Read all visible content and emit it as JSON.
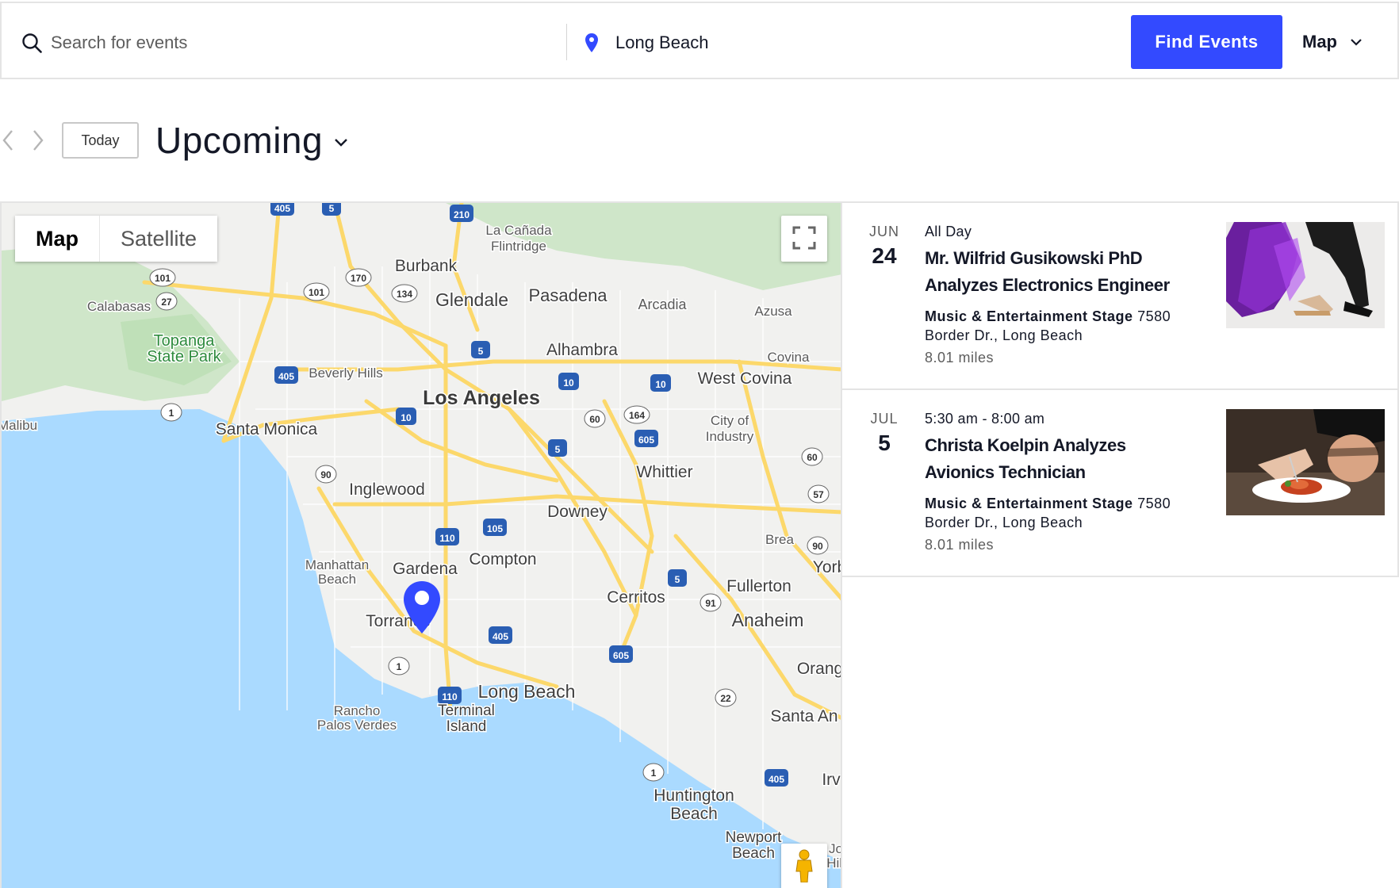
{
  "search": {
    "placeholder": "Search for events",
    "location_value": "Long Beach",
    "find_label": "Find Events",
    "view_label": "Map"
  },
  "datebar": {
    "today_label": "Today",
    "range_label": "Upcoming"
  },
  "map": {
    "type_map": "Map",
    "type_satellite": "Satellite",
    "labels": [
      "La Cañada",
      "Flintridge",
      "Burbank",
      "Glendale",
      "Pasadena",
      "Arcadia",
      "Azusa",
      "Calabasas",
      "Topanga",
      "State Park",
      "Alhambra",
      "Covina",
      "Beverly Hills",
      "Los Angeles",
      "West Covina",
      "Malibu",
      "Santa Monica",
      "City of",
      "Industry",
      "Whittier",
      "Inglewood",
      "Downey",
      "Brea",
      "Manhattan",
      "Beach",
      "Gardena",
      "Compton",
      "Yorb",
      "Fullerton",
      "Cerritos",
      "Anaheim",
      "Torrance",
      "Orang",
      "Long Beach",
      "Rancho",
      "Palos Verdes",
      "Terminal",
      "Island",
      "Santa An",
      "Irv",
      "Huntington",
      "Beach",
      "Newport",
      "Beach",
      "Jo",
      "Hill"
    ],
    "shields": [
      "405",
      "5",
      "210",
      "170",
      "101",
      "134",
      "101",
      "27",
      "5",
      "405",
      "10",
      "10",
      "1",
      "10",
      "60",
      "164",
      "605",
      "5",
      "60",
      "90",
      "57",
      "110",
      "105",
      "90",
      "5",
      "91",
      "405",
      "605",
      "1",
      "110",
      "22",
      "1",
      "405"
    ]
  },
  "events": [
    {
      "month": "JUN",
      "day": "24",
      "time": "All Day",
      "title": "Mr. Wilfrid Gusikowski PhD Analyzes Electronics Engineer",
      "venue": "Music & Entertainment Stage",
      "address": "7580 Border Dr., Long Beach",
      "distance": "8.01 miles"
    },
    {
      "month": "JUL",
      "day": "5",
      "time": "5:30 am - 8:00 am",
      "title": "Christa Koelpin Analyzes Avionics Technician",
      "venue": "Music & Entertainment Stage",
      "address": "7580 Border Dr., Long Beach",
      "distance": "8.01 miles"
    }
  ],
  "colors": {
    "accent": "#334aff",
    "ocean": "#aadaff",
    "land": "#f2f2f2",
    "park": "#c8e6c4",
    "highway": "#fce38a",
    "text": "#141827"
  }
}
